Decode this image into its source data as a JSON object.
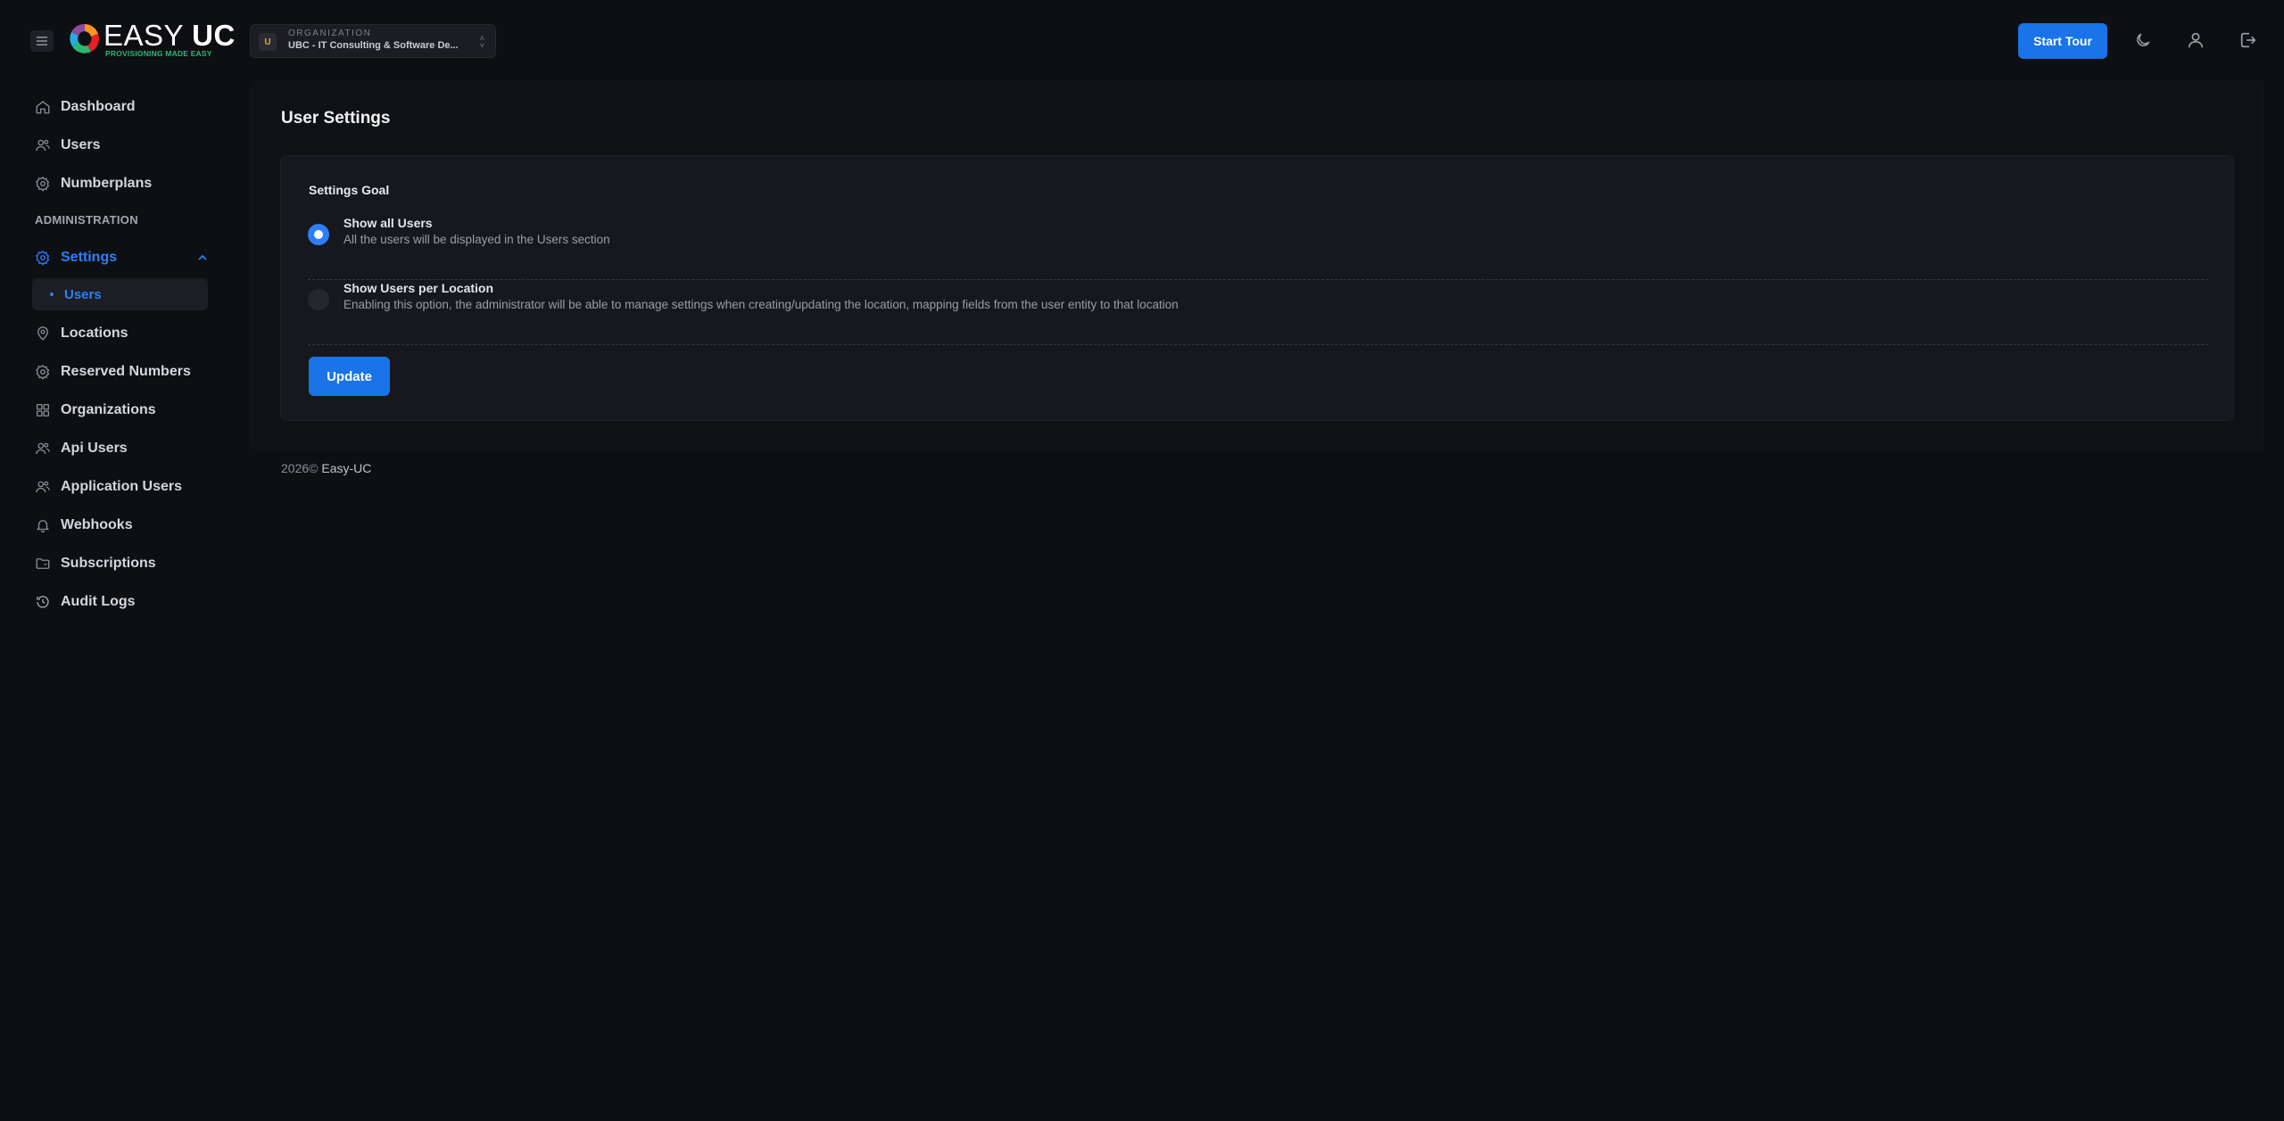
{
  "header": {
    "logo_text_light": "EASY ",
    "logo_text_bold": "UC",
    "logo_tagline": "PROVISIONING MADE EASY",
    "org_caption": "ORGANIZATION",
    "org_initial": "U",
    "org_name": "UBC - IT Consulting & Software De...",
    "start_tour_label": "Start Tour",
    "icons": [
      "menu-icon",
      "moon-icon",
      "user-icon",
      "logout-icon"
    ]
  },
  "sidebar": {
    "items_top": [
      {
        "label": "Dashboard",
        "icon": "home-icon"
      },
      {
        "label": "Users",
        "icon": "users-icon"
      },
      {
        "label": "Numberplans",
        "icon": "gear-icon"
      }
    ],
    "section_label": "ADMINISTRATION",
    "settings_label": "Settings",
    "settings_sub_label": "Users",
    "items_bottom": [
      {
        "label": "Locations",
        "icon": "map-pin-icon"
      },
      {
        "label": "Reserved Numbers",
        "icon": "gear-icon"
      },
      {
        "label": "Organizations",
        "icon": "grid-icon"
      },
      {
        "label": "Api Users",
        "icon": "users-icon"
      },
      {
        "label": "Application Users",
        "icon": "users-icon"
      },
      {
        "label": "Webhooks",
        "icon": "bell-icon"
      },
      {
        "label": "Subscriptions",
        "icon": "folder-icon"
      },
      {
        "label": "Audit Logs",
        "icon": "history-icon"
      }
    ]
  },
  "main": {
    "page_title": "User Settings",
    "card_title": "Settings Goal",
    "options": [
      {
        "title": "Show all Users",
        "description": "All the users will be displayed in the Users section",
        "selected": true
      },
      {
        "title": "Show Users per Location",
        "description": "Enabling this option, the administrator will be able to manage settings when creating/updating the location, mapping fields from the user entity to that location",
        "selected": false
      }
    ],
    "update_label": "Update"
  },
  "footer": {
    "year": "2026©",
    "brand": "Easy-UC"
  },
  "colors": {
    "accent": "#1a73e8",
    "active_text": "#2d7ff9",
    "background": "#0e0f13"
  }
}
